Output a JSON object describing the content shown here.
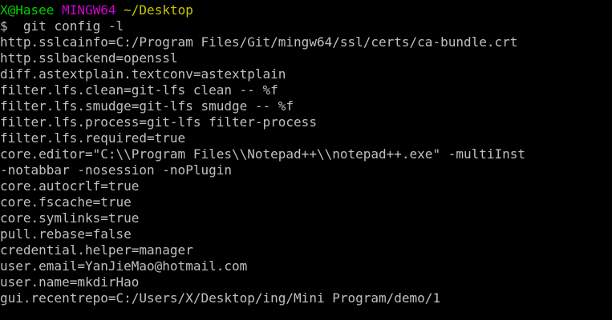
{
  "prompt": {
    "user_host": "X@Hasee",
    "shell": "MINGW64",
    "cwd": "~/Desktop",
    "symbol": "$",
    "command": "git config -l"
  },
  "colors": {
    "background": "#000000",
    "text": "#c0c0c0",
    "user_host": "#00d000",
    "shell": "#d000d0",
    "cwd": "#c8c800"
  },
  "output": [
    "http.sslcainfo=C:/Program Files/Git/mingw64/ssl/certs/ca-bundle.crt",
    "http.sslbackend=openssl",
    "diff.astextplain.textconv=astextplain",
    "filter.lfs.clean=git-lfs clean -- %f",
    "filter.lfs.smudge=git-lfs smudge -- %f",
    "filter.lfs.process=git-lfs filter-process",
    "filter.lfs.required=true",
    "core.editor=\"C:\\\\Program Files\\\\Notepad++\\\\notepad++.exe\" -multiInst",
    "-notabbar -nosession -noPlugin",
    "core.autocrlf=true",
    "core.fscache=true",
    "core.symlinks=true",
    "pull.rebase=false",
    "credential.helper=manager",
    "user.email=YanJieMao@hotmail.com",
    "user.name=mkdirHao",
    "gui.recentrepo=C:/Users/X/Desktop/ing/Mini Program/demo/1"
  ]
}
